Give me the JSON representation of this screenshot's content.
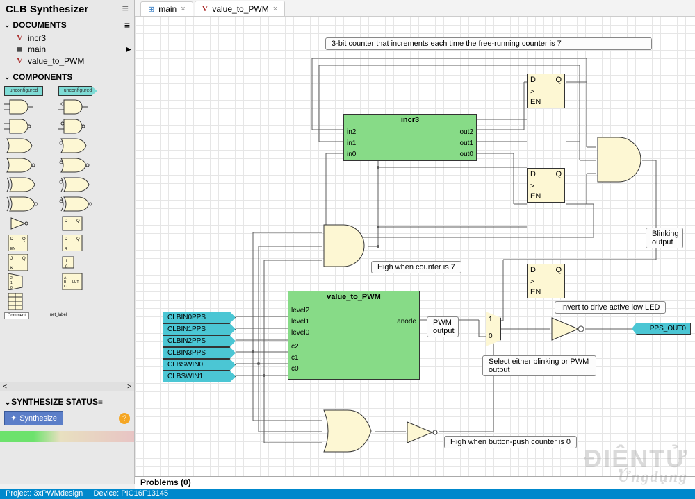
{
  "app": {
    "title": "CLB Synthesizer"
  },
  "sidebar": {
    "sections": {
      "documents": {
        "header": "DOCUMENTS",
        "items": [
          {
            "type": "v",
            "label": "incr3"
          },
          {
            "type": "d",
            "label": "main"
          },
          {
            "type": "v",
            "label": "value_to_PWM"
          }
        ]
      },
      "components": {
        "header": "COMPONENTS"
      },
      "synth": {
        "header": "SYNTHESIZE STATUS",
        "button": "Synthesize",
        "help": "?"
      }
    },
    "palette_labels": {
      "unconfigured1": "unconfigured",
      "unconfigured2": "unconfigured",
      "comment": "Comment",
      "netlabel": "net_label"
    }
  },
  "tabs": [
    {
      "kind": "d",
      "label": "main",
      "active": true
    },
    {
      "kind": "v",
      "label": "value_to_PWM",
      "active": false
    }
  ],
  "diagram": {
    "notes": {
      "counter3bit": "3-bit counter that increments each time the free-running counter is 7",
      "high7": "High when counter is 7",
      "pwm_output": "PWM output",
      "blinking_output": "Blinking output",
      "select_out": "Select either blinking or PWM output",
      "invert": "Invert to drive active low LED",
      "high_btn0": "High when button-push counter is 0"
    },
    "incr3": {
      "title": "incr3",
      "in": [
        "in2",
        "in1",
        "in0"
      ],
      "out": [
        "out2",
        "out1",
        "out0"
      ]
    },
    "v2pwm": {
      "title": "value_to_PWM",
      "left": [
        "level2",
        "level1",
        "level0",
        "c2",
        "c1",
        "c0"
      ],
      "right": [
        "anode"
      ]
    },
    "dff_labels": {
      "D": "D",
      "Q": "Q",
      "EN": "EN",
      "clk": ">"
    },
    "inports": [
      "CLBIN0PPS",
      "CLBIN1PPS",
      "CLBIN2PPS",
      "CLBIN3PPS",
      "CLBSWIN0",
      "CLBSWIN1"
    ],
    "mux": {
      "in1": "1",
      "in0": "0"
    },
    "outport": "PPS_OUT0"
  },
  "problems": {
    "label": "Problems (0)"
  },
  "status": {
    "project": "Project: 3xPWMdesign",
    "device": "Device: PIC16F13145"
  },
  "watermark": {
    "line1": "ĐIỆNTỬ",
    "line2": "Ứngdụng"
  }
}
